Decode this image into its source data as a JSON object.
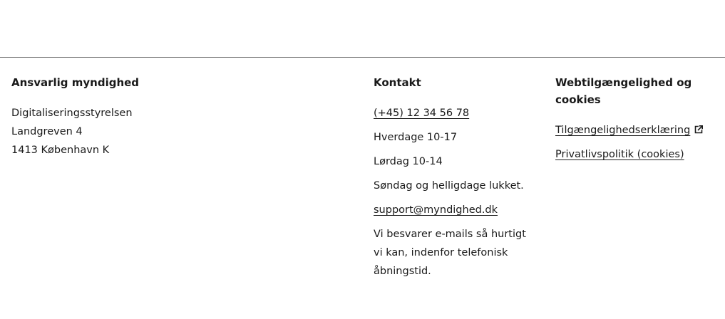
{
  "footer": {
    "authority": {
      "heading": "Ansvarlig myndighed",
      "lines": [
        "Digitaliseringsstyrelsen",
        "Landgreven 4",
        "1413 København K"
      ]
    },
    "contact": {
      "heading": "Kontakt",
      "phone": "(+45) 12 34 56 78",
      "hours_weekdays": "Hverdage 10-17",
      "hours_saturday": "Lørdag 10-14",
      "hours_closed": "Søndag og helligdage lukket.",
      "email": "support@myndighed.dk",
      "email_note": "Vi besvarer e-mails så hurtigt vi kan, indenfor telefonisk åbningstid."
    },
    "accessibility": {
      "heading": "Webtilgængelighed og cookies",
      "links": [
        {
          "label": "Tilgængelighedserklæring",
          "icon": "external-link-icon"
        },
        {
          "label": "Privatlivspolitik (cookies)"
        }
      ]
    }
  }
}
